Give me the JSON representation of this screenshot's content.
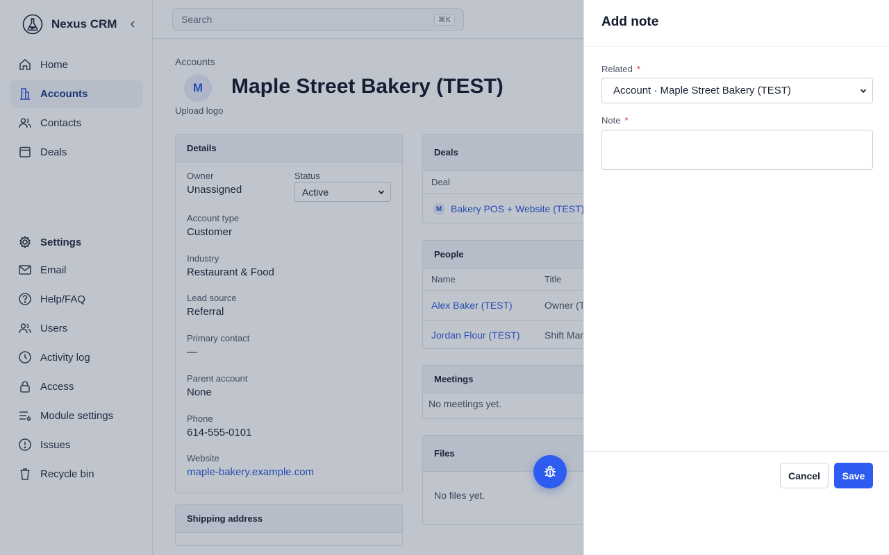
{
  "sidebar": {
    "brand": "Nexus CRM",
    "brand_icon": "flask-icon",
    "collapse_icon": "chevron-left-icon",
    "primary_items": [
      {
        "label": "Home",
        "icon": "home-icon"
      },
      {
        "label": "Accounts",
        "icon": "building-icon",
        "active": true
      },
      {
        "label": "Contacts",
        "icon": "users-icon"
      },
      {
        "label": "Deals",
        "icon": "calendar-icon"
      }
    ],
    "settings_label": "Settings",
    "settings_items": [
      {
        "label": "Email",
        "icon": "mail-icon"
      },
      {
        "label": "Help/FAQ",
        "icon": "help-circle-icon"
      },
      {
        "label": "Users",
        "icon": "users-icon"
      },
      {
        "label": "Activity log",
        "icon": "clock-icon"
      },
      {
        "label": "Access",
        "icon": "lock-icon"
      },
      {
        "label": "Module settings",
        "icon": "sliders-icon"
      },
      {
        "label": "Issues",
        "icon": "alert-circle-icon"
      },
      {
        "label": "Recycle bin",
        "icon": "trash-icon"
      }
    ]
  },
  "topbar": {
    "search_placeholder": "Search",
    "search_shortcut": "⌘K"
  },
  "page": {
    "breadcrumb": "Accounts",
    "avatar_initial": "M",
    "title": "Maple Street Bakery (TEST)",
    "upload_logo": "Upload logo"
  },
  "details": {
    "heading": "Details",
    "owner_label": "Owner",
    "owner_value": "Unassigned",
    "status_label": "Status",
    "status_value": "Active",
    "account_type_label": "Account type",
    "account_type_value": "Customer",
    "industry_label": "Industry",
    "industry_value": "Restaurant & Food",
    "lead_source_label": "Lead source",
    "lead_source_value": "Referral",
    "primary_contact_label": "Primary contact",
    "primary_contact_value": "—",
    "parent_account_label": "Parent account",
    "parent_account_value": "None",
    "phone_label": "Phone",
    "phone_value": "614-555-0101",
    "website_label": "Website",
    "website_value": "maple-bakery.example.com"
  },
  "shipping": {
    "heading": "Shipping address"
  },
  "deals": {
    "heading": "Deals",
    "column": "Deal",
    "rows": [
      {
        "avatar": "M",
        "name": "Bakery POS + Website (TEST)"
      }
    ]
  },
  "people": {
    "heading": "People",
    "col_name": "Name",
    "col_title": "Title",
    "rows": [
      {
        "name": "Alex Baker (TEST)",
        "title": "Owner (T"
      },
      {
        "name": "Jordan Flour (TEST)",
        "title": "Shift Mar"
      }
    ]
  },
  "meetings": {
    "heading": "Meetings",
    "empty": "No meetings yet."
  },
  "files": {
    "heading": "Files",
    "empty": "No files yet."
  },
  "fab": {
    "icon": "bug-icon"
  },
  "drawer": {
    "title": "Add note",
    "related_label": "Related",
    "related_value": "Account · Maple Street Bakery (TEST)",
    "note_label": "Note",
    "required_mark": "*",
    "note_value": "",
    "cancel": "Cancel",
    "save": "Save"
  },
  "colors": {
    "accent": "#2f5cf0",
    "link": "#2b56d8",
    "required": "#d0363a",
    "overlay": "rgba(30,45,75,0.28)"
  }
}
